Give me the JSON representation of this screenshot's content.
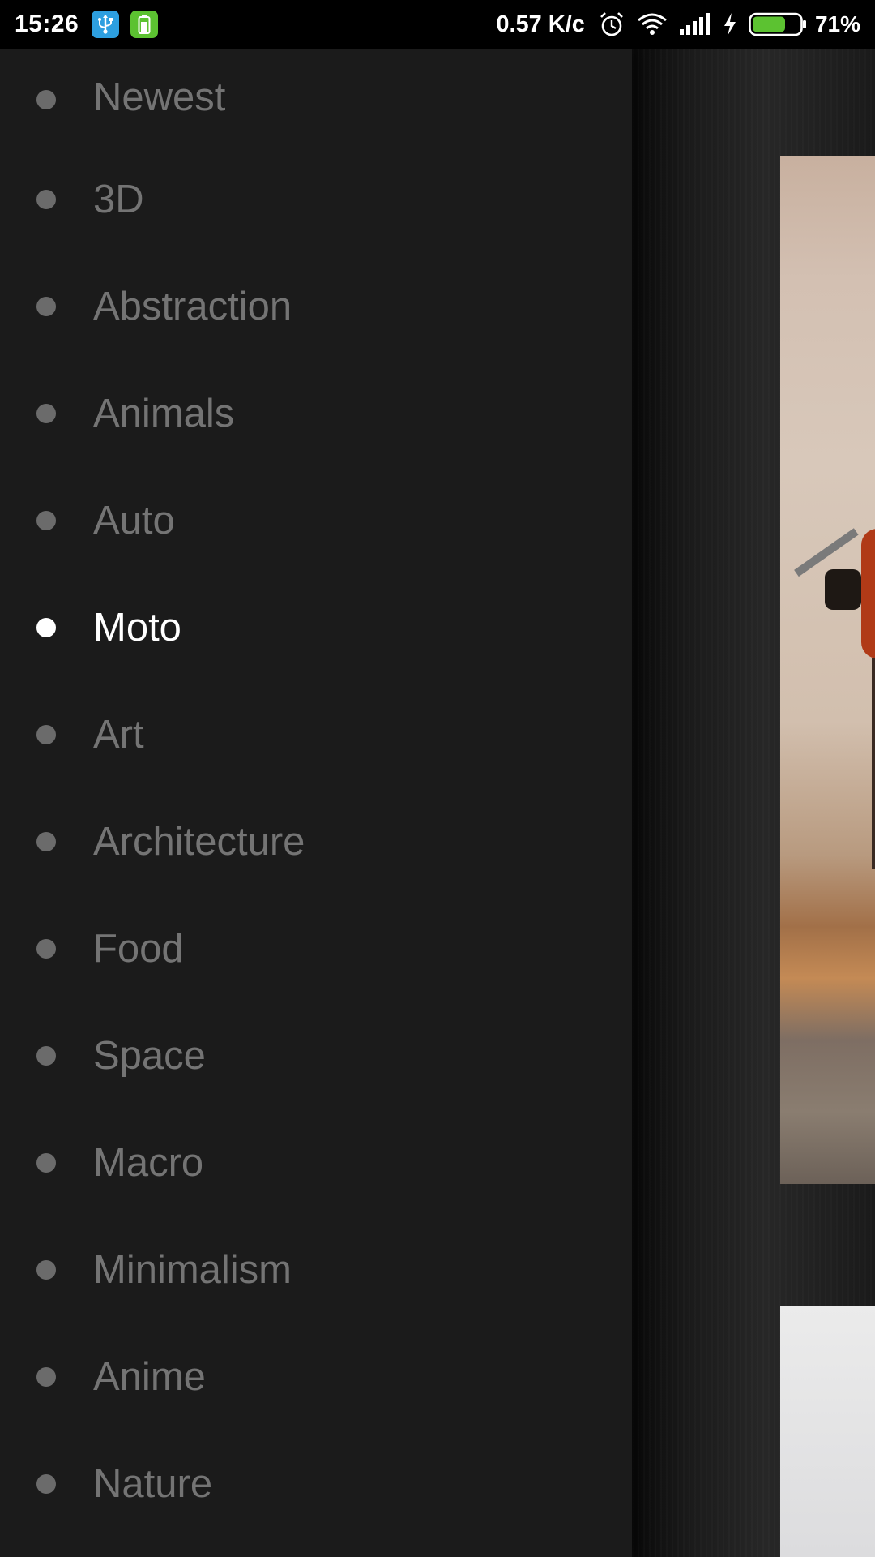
{
  "status_bar": {
    "time": "15:26",
    "network_speed": "0.57 K/c",
    "battery_percent": "71%",
    "battery_level": 0.71,
    "notification_icons": [
      "usb-icon",
      "battery-saver-app-icon"
    ],
    "system_icons": [
      "alarm-icon",
      "wifi-icon",
      "signal-icon",
      "charging-icon",
      "battery-icon"
    ]
  },
  "drawer": {
    "items": [
      {
        "label": "Newest",
        "active": false
      },
      {
        "label": "3D",
        "active": false
      },
      {
        "label": "Abstraction",
        "active": false
      },
      {
        "label": "Animals",
        "active": false
      },
      {
        "label": "Auto",
        "active": false
      },
      {
        "label": "Moto",
        "active": true
      },
      {
        "label": "Art",
        "active": false
      },
      {
        "label": "Architecture",
        "active": false
      },
      {
        "label": "Food",
        "active": false
      },
      {
        "label": "Space",
        "active": false
      },
      {
        "label": "Macro",
        "active": false
      },
      {
        "label": "Minimalism",
        "active": false
      },
      {
        "label": "Anime",
        "active": false
      },
      {
        "label": "Nature",
        "active": false
      }
    ]
  },
  "colors": {
    "drawer_bg": "#1b1b1b",
    "item_inactive": "#747474",
    "item_active": "#ffffff",
    "battery_fill": "#5cc231"
  }
}
